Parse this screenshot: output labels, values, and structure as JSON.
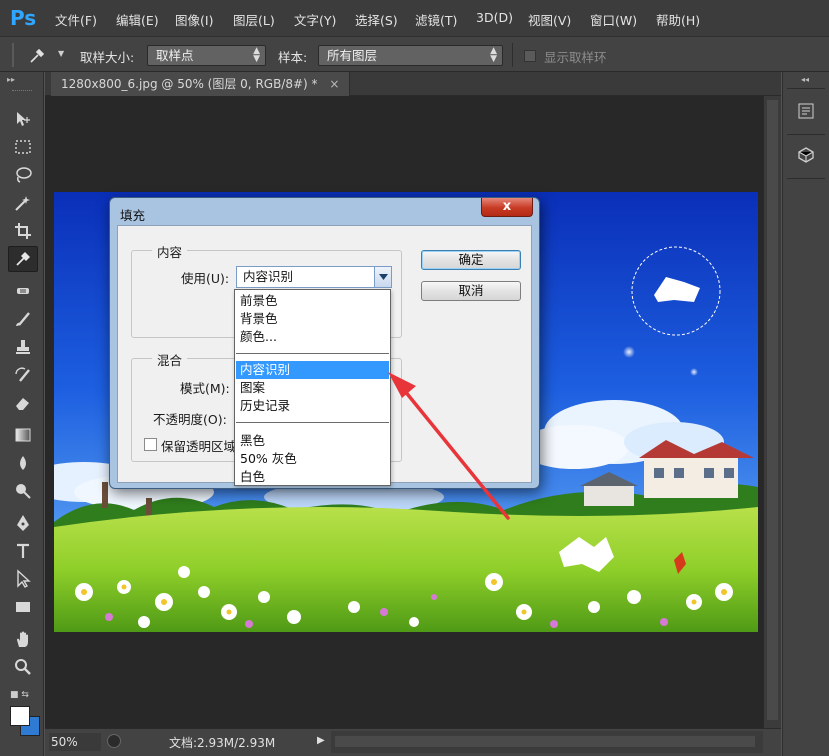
{
  "app": {
    "logo": "Ps"
  },
  "menu": [
    "文件(F)",
    "编辑(E)",
    "图像(I)",
    "图层(L)",
    "文字(Y)",
    "选择(S)",
    "滤镜(T)",
    "3D(D)",
    "视图(V)",
    "窗口(W)",
    "帮助(H)"
  ],
  "options": {
    "sample_size_label": "取样大小:",
    "sample_size_value": "取样点",
    "sample_label": "样本:",
    "sample_value": "所有图层",
    "show_ring_label": "显示取样环"
  },
  "document": {
    "tab_title": "1280x800_6.jpg @ 50% (图层 0, RGB/8#) *",
    "tab_close": "×"
  },
  "status": {
    "zoom": "50%",
    "doc_info": "文档:2.93M/2.93M",
    "arrow": "▶"
  },
  "dialog": {
    "title": "填充",
    "close": "x",
    "content_group": "内容",
    "use_label": "使用(U):",
    "use_value": "内容识别",
    "ok_button": "确定",
    "cancel_button": "取消",
    "blend_group": "混合",
    "mode_label": "模式(M):",
    "opacity_label": "不透明度(O):",
    "preserve_label": "保留透明区域"
  },
  "dropdown": {
    "group1": [
      "前景色",
      "背景色",
      "颜色..."
    ],
    "group2": [
      "内容识别",
      "图案",
      "历史记录"
    ],
    "group3": [
      "黑色",
      "50% 灰色",
      "白色"
    ],
    "selected": "内容识别"
  },
  "colors": {
    "foreground": "#ffffff",
    "background": "#2f7bd3",
    "selection_highlight": "#3399ff",
    "annotation_arrow": "#e8353a"
  },
  "icons": {
    "tools": [
      "move-icon",
      "marquee-icon",
      "lasso-icon",
      "magic-wand-icon",
      "crop-icon",
      "eyedropper-icon",
      "healing-brush-icon",
      "brush-icon",
      "clone-stamp-icon",
      "history-brush-icon",
      "eraser-icon",
      "gradient-icon",
      "blur-icon",
      "dodge-icon",
      "pen-icon",
      "type-icon",
      "path-selection-icon",
      "rectangle-icon",
      "hand-icon",
      "zoom-icon"
    ],
    "right_panels": [
      "adjust-panel-icon",
      "3d-panel-icon"
    ]
  }
}
